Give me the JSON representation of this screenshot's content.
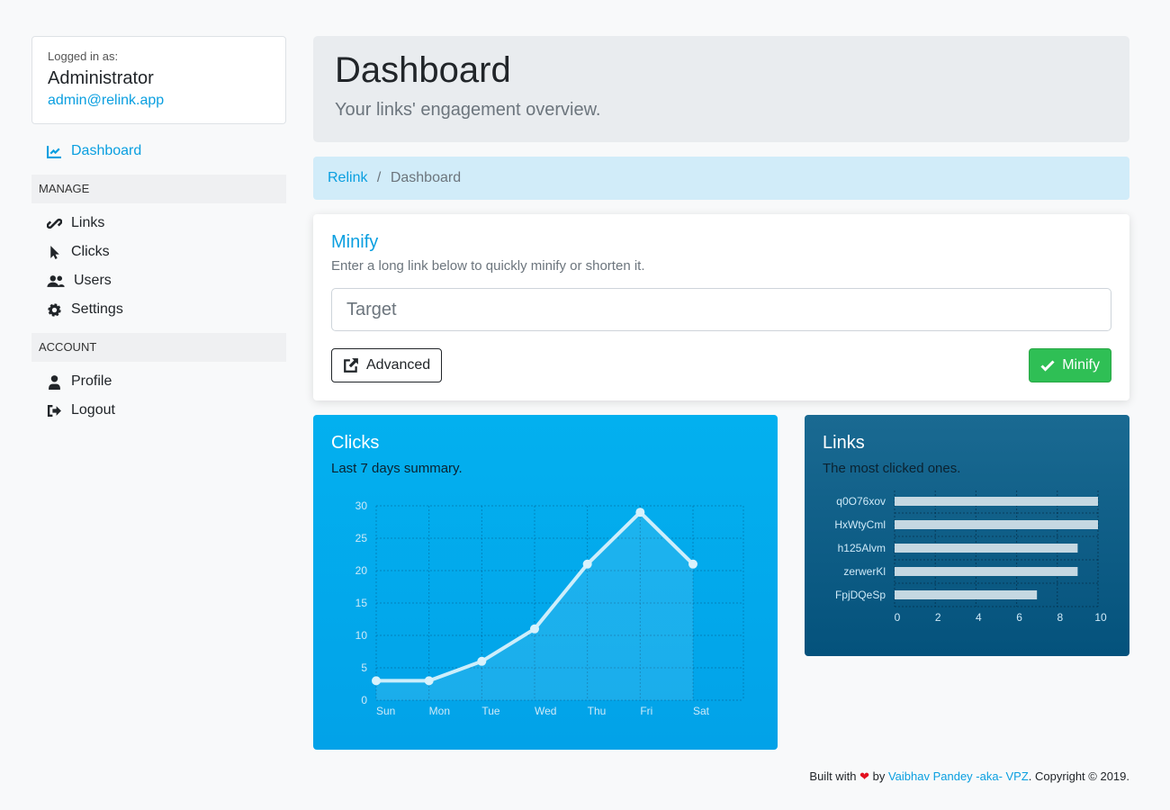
{
  "user": {
    "label": "Logged in as:",
    "name": "Administrator",
    "email": "admin@relink.app"
  },
  "nav": {
    "dashboard": "Dashboard",
    "manage": "MANAGE",
    "links": "Links",
    "clicks": "Clicks",
    "users": "Users",
    "settings": "Settings",
    "account": "ACCOUNT",
    "profile": "Profile",
    "logout": "Logout"
  },
  "header": {
    "title": "Dashboard",
    "subtitle": "Your links' engagement overview."
  },
  "breadcrumb": {
    "root": "Relink",
    "sep": "/",
    "current": "Dashboard"
  },
  "minify": {
    "title": "Minify",
    "description": "Enter a long link below to quickly minify or shorten it.",
    "placeholder": "Target",
    "advanced": "Advanced",
    "submit": "Minify"
  },
  "chart_data": [
    {
      "type": "line",
      "title": "Clicks",
      "subtitle": "Last 7 days summary.",
      "categories": [
        "Sun",
        "Mon",
        "Tue",
        "Wed",
        "Thu",
        "Fri",
        "Sat"
      ],
      "values": [
        3,
        3,
        6,
        11,
        21,
        29,
        21
      ],
      "ylim": [
        0,
        30
      ],
      "yticks": [
        0,
        5,
        10,
        15,
        20,
        25,
        30
      ],
      "grid": true
    },
    {
      "type": "bar",
      "orientation": "horizontal",
      "title": "Links",
      "subtitle": "The most clicked ones.",
      "categories": [
        "q0O76xov",
        "HxWtyCml",
        "h125Alvm",
        "zerwerKl",
        "FpjDQeSp"
      ],
      "values": [
        10,
        10,
        9,
        9,
        7
      ],
      "xlim": [
        0,
        10
      ],
      "xticks": [
        0,
        2,
        4,
        6,
        8,
        10
      ],
      "grid": true
    }
  ],
  "footer": {
    "built": "Built with",
    "by": "by",
    "author": "Vaibhav Pandey -aka- VPZ",
    "copyright": ". Copyright © 2019."
  },
  "colors": {
    "accent": "#0a9fe0",
    "success": "#2fbf55",
    "heart": "#e3101f"
  }
}
